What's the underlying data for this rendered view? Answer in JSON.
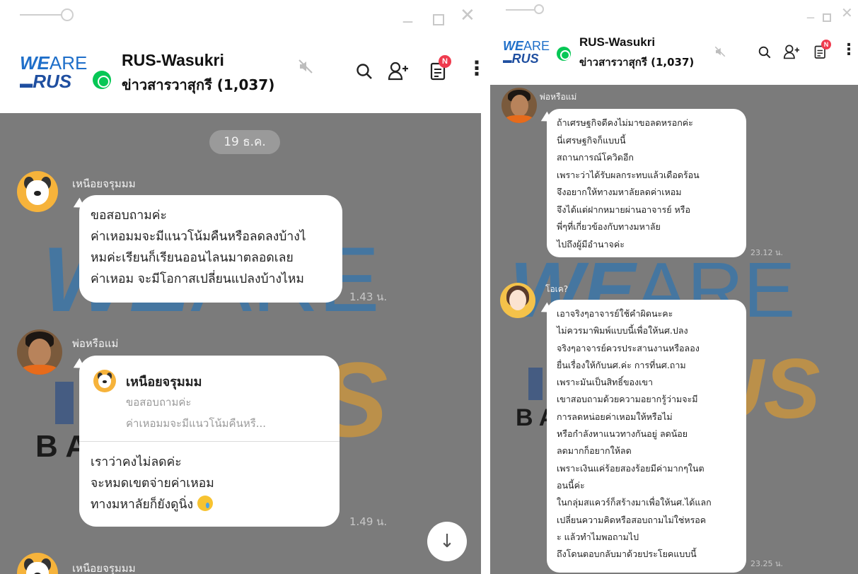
{
  "group": {
    "name": "RUS-Wasukri",
    "subtitle": "ข่าวสารวาสุกรี (1,037)",
    "logo_top_we": "WE",
    "logo_top_are": "ARE",
    "logo_bottom_rus": "RUS",
    "badge": "N"
  },
  "icons": {
    "window_close": "✕",
    "window_minimize": "_",
    "search": "⚲",
    "add_friend": "♙",
    "mute": "🔇",
    "menu": "⋮",
    "scroll_down": "↓"
  },
  "watermark": {
    "we": "WE",
    "are": "ARE",
    "rus": "US",
    "b": "B A"
  },
  "left": {
    "date": "19 ธ.ค.",
    "msg1": {
      "sender": "เหนือยจรุมมม",
      "lines": [
        "ขอสอบถามค่ะ",
        "ค่าเหอมมจะมีแนวโน้มคืนหรือลดลงบ้างไ",
        "หมค่ะเรียนก็เรียนออนไลนมาตลอดเลย",
        "ค่าเหอม จะมีโอกาสเปลี่ยนแปลงบ้างไหม"
      ],
      "time": "1.43 น."
    },
    "msg2": {
      "sender": "พ่อหรือแม่",
      "quote_name": "เหนือยจรุมมม",
      "quote_lines": [
        "ขอสอบถามค่ะ",
        "ค่าเหอมมจะมีแนวโน้มคืนหรื..."
      ],
      "lines": [
        "เราว่าคงไม่ลดค่ะ",
        "จะหมดเขตจ่ายค่าเหอม",
        "ทางมหาลัยก็ยังดูนิ่ง"
      ],
      "time": "1.49 น."
    },
    "msg3_sender": "เหนือยจรุมมม"
  },
  "right": {
    "msg1": {
      "sender": "พ่อหรือแม่",
      "lines": [
        "ถ้าเศรษฐกิจดีคงไม่มาขอลดหรอกค่ะ",
        "นี่เศรษฐกิจก็แบบนี้",
        "สถานการณ์โควิดอีก",
        "เพราะว่าได้รับผลกระทบแล้วเดือดร้อน",
        "จึงอยากให้ทางมหาลัยลดค่าเหอม",
        "จึงได้แต่ฝากหมายผ่านอาจารย์ หรือ",
        "พี่ๆที่เกี่ยวข้องกับทางมหาลัย",
        "ไปถึงผู้มีอำนาจค่ะ"
      ],
      "time": "23.12 น."
    },
    "msg2": {
      "sender": "โอเค?",
      "lines": [
        "เอาจริงๆอาจารย์ใช้คำผิดนะคะ",
        "ไม่ควรมาพิมพ์แบบนี้เพื่อให้นศ.ปลง",
        "จริงๆอาจารย์ควรประสานงานหรือลอง",
        "ยื่นเรื่องให้กับนศ.ค่ะ การที่นศ.ถาม",
        "เพราะมันเป็นสิทธิ์ของเขา",
        "เขาสอบถามด้วยความอยากรู้ว่ามจะมี",
        "การลดหน่อยค่าเหอมให้หรือไม่",
        "หรือกำลังหาแนวทางกันอยู่ ลดน้อย",
        "ลดมากก็อยากให้ลด",
        "เพราะเงินแค่ร้อยสองร้อยมีค่ามากๆในต",
        "อนนี้ค่ะ",
        "ในกลุ่มสแควร์ก็สร้างมาเพื่อให้นศ.ได้แลก",
        "เปลี่ยนความคิดหรือสอบถามไม่ใช่หรอค",
        "ะ แล้วทำไมพอถามไป",
        "ถึงโดนตอบกลับมาด้วยประโยคแบบนี้"
      ],
      "time": "23.25 น."
    }
  }
}
